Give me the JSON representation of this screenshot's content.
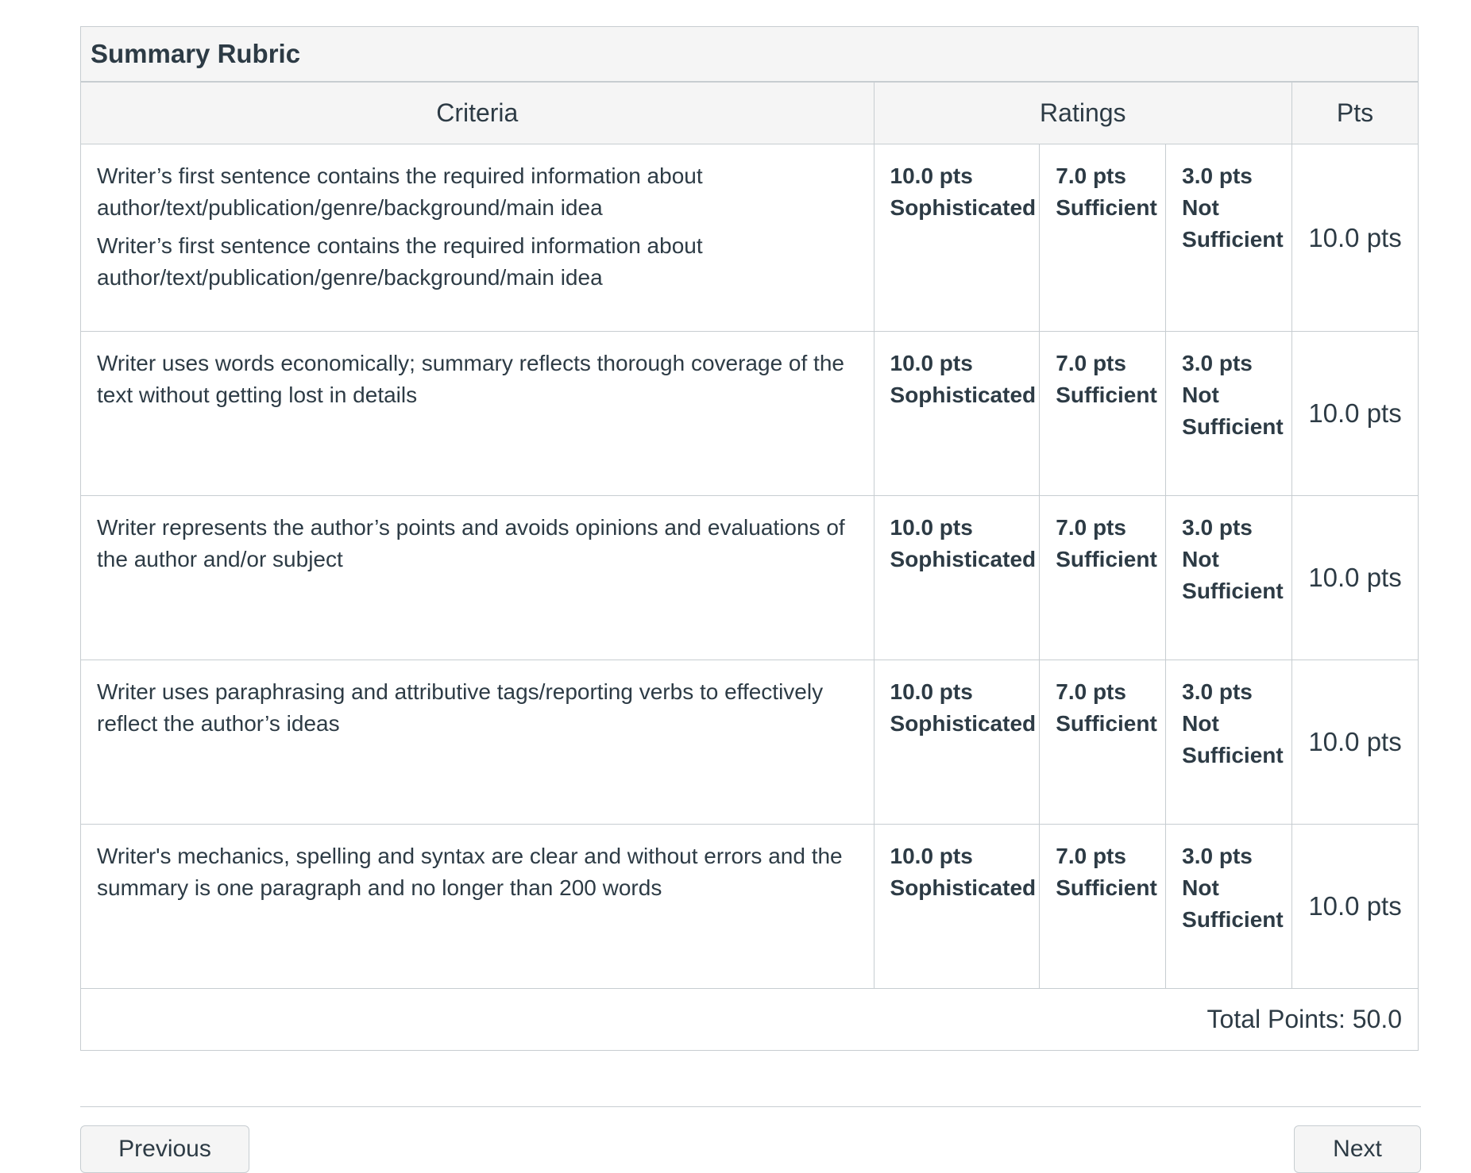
{
  "rubric": {
    "title": "Summary Rubric",
    "headers": {
      "criteria": "Criteria",
      "ratings": "Ratings",
      "pts": "Pts"
    },
    "rows": [
      {
        "descriptions": [
          "Writer’s first sentence contains the required information about author/text/publication/genre/background/main idea",
          "Writer’s first sentence contains the required information about author/text/publication/genre/background/main idea"
        ],
        "ratings": [
          {
            "points": "10.0 pts",
            "label": "Sophisticated"
          },
          {
            "points": "7.0 pts",
            "label": "Sufficient"
          },
          {
            "points": "3.0 pts",
            "label": "Not Sufficient"
          }
        ],
        "pts": "10.0 pts"
      },
      {
        "descriptions": [
          "Writer uses words economically; summary reflects thorough coverage of the text without getting lost in details"
        ],
        "ratings": [
          {
            "points": "10.0 pts",
            "label": "Sophisticated"
          },
          {
            "points": "7.0 pts",
            "label": "Sufficient"
          },
          {
            "points": "3.0 pts",
            "label": "Not Sufficient"
          }
        ],
        "pts": "10.0 pts"
      },
      {
        "descriptions": [
          "Writer represents the author’s points and avoids opinions and evaluations of the author and/or subject"
        ],
        "ratings": [
          {
            "points": "10.0 pts",
            "label": "Sophisticated"
          },
          {
            "points": "7.0 pts",
            "label": "Sufficient"
          },
          {
            "points": "3.0 pts",
            "label": "Not Sufficient"
          }
        ],
        "pts": "10.0 pts"
      },
      {
        "descriptions": [
          "Writer uses paraphrasing and attributive tags/reporting verbs to effectively reflect the author’s ideas"
        ],
        "ratings": [
          {
            "points": "10.0 pts",
            "label": "Sophisticated"
          },
          {
            "points": "7.0 pts",
            "label": "Sufficient"
          },
          {
            "points": "3.0 pts",
            "label": "Not Sufficient"
          }
        ],
        "pts": "10.0 pts"
      },
      {
        "descriptions": [
          "Writer's mechanics, spelling and syntax are clear and without errors and the summary is one paragraph and no longer than 200 words"
        ],
        "ratings": [
          {
            "points": "10.0 pts",
            "label": "Sophisticated"
          },
          {
            "points": "7.0 pts",
            "label": "Sufficient"
          },
          {
            "points": "3.0 pts",
            "label": "Not Sufficient"
          }
        ],
        "pts": "10.0 pts"
      }
    ],
    "total": "Total Points: 50.0"
  },
  "footer": {
    "previous_label": "Previous",
    "next_label": "Next"
  },
  "colors": {
    "text": "#2d3b45",
    "border": "#c7cdd1",
    "header_bg": "#f5f5f5"
  }
}
